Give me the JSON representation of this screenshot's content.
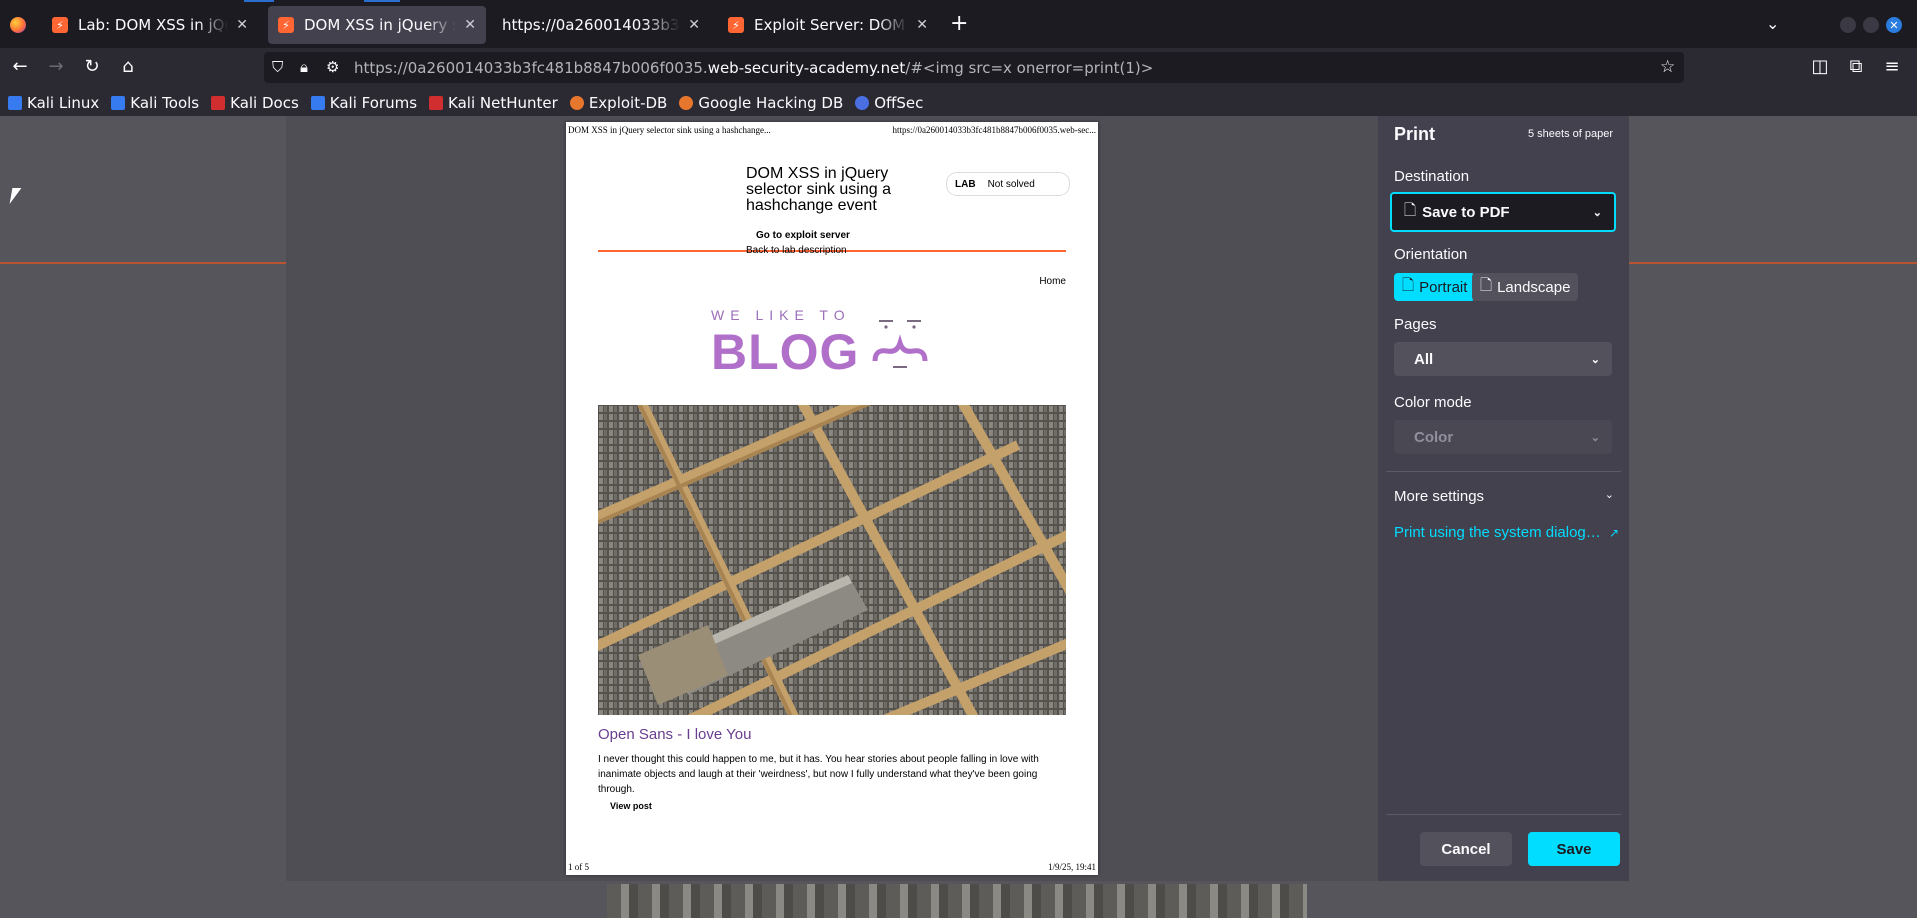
{
  "browser": {
    "tabs": [
      {
        "label": "Lab: DOM XSS in jQuery selector sink using a hashchange event",
        "active": false
      },
      {
        "label": "DOM XSS in jQuery selector sink using a hashchange event",
        "active": true
      },
      {
        "label": "https://0a260014033b3fc481b8847b006f0035.web-security-academy.net",
        "active": false
      },
      {
        "label": "Exploit Server: DOM XSS in jQuery selector sink using a hashchange event",
        "active": false
      }
    ],
    "url_prefix": "https://0a260014033b3fc481b8847b006f0035.",
    "url_domain": "web-security-academy.net",
    "url_suffix": "/#<img src=x onerror=print(1)>",
    "bookmarks": [
      "Kali Linux",
      "Kali Tools",
      "Kali Docs",
      "Kali Forums",
      "Kali NetHunter",
      "Exploit-DB",
      "Google Hacking DB",
      "OffSec"
    ]
  },
  "preview": {
    "header_left": "DOM XSS in jQuery selector sink using a hashchange...",
    "header_right": "https://0a260014033b3fc481b8847b006f0035.web-sec...",
    "footer_left": "1 of 5",
    "footer_right": "1/9/25, 19:41",
    "lab_title": "DOM XSS in jQuery selector sink using a hashchange event",
    "lab_badge": "LAB",
    "lab_status": "Not solved",
    "link_exploit": "Go to exploit server",
    "link_back": "Back to lab description",
    "home": "Home",
    "blog_tagline": "WE LIKE TO",
    "blog_word": "BLOG",
    "post_title": "Open Sans - I love You",
    "post_text": "I never thought this could happen to me, but it has. You hear stories about people falling in love with inanimate objects and laugh at their 'weirdness', but now I fully understand what they've been going through.",
    "view_post": "View post"
  },
  "print": {
    "title": "Print",
    "sheets": "5 sheets of paper",
    "destination_label": "Destination",
    "destination_value": "Save to PDF",
    "orientation_label": "Orientation",
    "portrait": "Portrait",
    "landscape": "Landscape",
    "pages_label": "Pages",
    "pages_value": "All",
    "color_label": "Color mode",
    "color_value": "Color",
    "more_settings": "More settings",
    "system_dialog": "Print using the system dialog…",
    "cancel": "Cancel",
    "save": "Save"
  },
  "colors": {
    "accent": "#00ddff",
    "brand_orange": "#ff6633",
    "blog_purple": "#b070c9"
  }
}
